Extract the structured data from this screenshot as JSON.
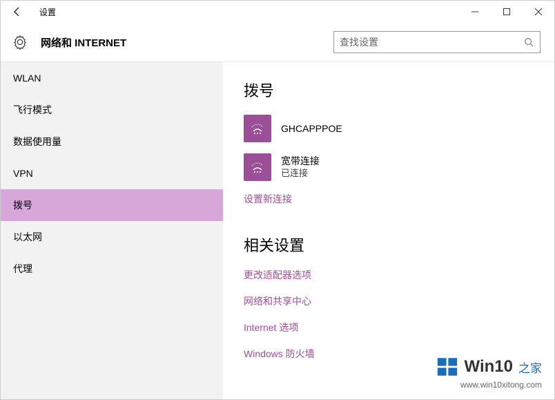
{
  "titlebar": {
    "title": "设置"
  },
  "header": {
    "title": "网络和 INTERNET",
    "search_placeholder": "查找设置"
  },
  "sidebar": {
    "items": [
      {
        "label": "WLAN"
      },
      {
        "label": "飞行模式"
      },
      {
        "label": "数据使用量"
      },
      {
        "label": "VPN"
      },
      {
        "label": "拨号"
      },
      {
        "label": "以太网"
      },
      {
        "label": "代理"
      }
    ],
    "selected_index": 4
  },
  "main": {
    "heading": "拨号",
    "connections": [
      {
        "name": "GHCAPPPOE",
        "status": "",
        "icon": "dialup-icon"
      },
      {
        "name": "宽带连接",
        "status": "已连接",
        "icon": "dialup-icon"
      }
    ],
    "new_connection_link": "设置新连接",
    "related_heading": "相关设置",
    "related_links": [
      "更改适配器选项",
      "网络和共享中心",
      "Internet 选项",
      "Windows 防火墙"
    ]
  },
  "colors": {
    "accent": "#9b4f96",
    "selected": "#d9a6d9"
  },
  "watermark": {
    "brand": "Win10",
    "suffix": "之家",
    "url": "www.win10xitong.com"
  }
}
